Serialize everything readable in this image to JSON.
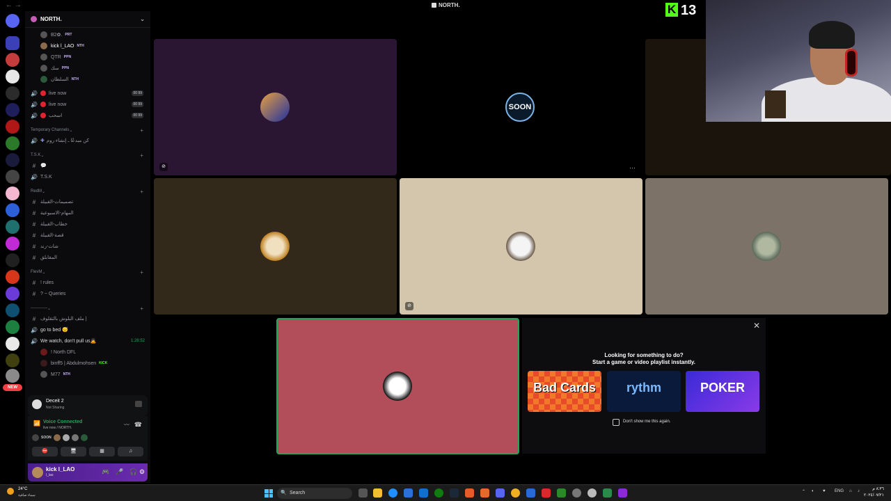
{
  "window": {
    "title": "NORTH."
  },
  "server": {
    "name": "NORTH."
  },
  "channels": {
    "users_top": [
      {
        "name": "B2✿.",
        "tag": "PRT"
      },
      {
        "name": "kick l_LAO",
        "tag": "NTH"
      },
      {
        "name": "QTR",
        "tag": "PPN"
      },
      {
        "name": "سك",
        "tag": "PPN"
      },
      {
        "name": "السلطان",
        "tag": "NTH"
      }
    ],
    "voice_live": [
      {
        "label": "live now",
        "limit": "00 99"
      },
      {
        "label": "live now",
        "limit": "00 99"
      },
      {
        "label": "اسحب",
        "limit": "00 99"
      }
    ],
    "temp_category": "Temporary Channels",
    "temp_create": "كن مبدعًا ـ إنشاء روم",
    "tsk_category": "T.S.K",
    "tsk_channels": [
      "T.S.K"
    ],
    "redm_category": "RedM",
    "redm_channels": [
      "تصميمات-القبيلة",
      "المهام-الاسبوعية",
      "خطاب-القبيلة",
      "قصة-القبيلة",
      "شات-رند",
      "المقابلق"
    ],
    "flevm_category": "FlevM",
    "flevm_channels": [
      "! rules",
      "? ~ Queries"
    ],
    "misc_category": "------------",
    "misc_text": "ملف البلوش بالتقلوف |",
    "bed_voice": "go to bed 😴",
    "watch_voice": "We watch, don't pull us🙇",
    "watch_time": "1:28:52",
    "watch_users": [
      {
        "name": "! North DFL",
        "tag": ""
      },
      {
        "name": "binff5 | Abdulmohsen",
        "tag": "KICK"
      },
      {
        "name": "M77",
        "tag": "NTH"
      }
    ]
  },
  "game_panel": {
    "name": "Deceit 2",
    "status": "Not Sharing"
  },
  "voice_panel": {
    "title": "Voice Connected",
    "channel": "live now / NORTH.",
    "soon_label": "SOON"
  },
  "user_panel": {
    "name": "kick l_LAO",
    "status": "l_lao"
  },
  "rail": {
    "new_label": "NEW"
  },
  "kick_overlay": {
    "count": "13"
  },
  "promo": {
    "title": "Looking for something to do?",
    "subtitle": "Start a game or video playlist instantly.",
    "dont_show": "Don't show me this again.",
    "cards": [
      "Bad Cards",
      "rythm",
      "POKER"
    ]
  },
  "tiles": {
    "soon_label": "SOON"
  },
  "taskbar": {
    "temp": "24°C",
    "condition": "سماء صافية",
    "search": "Search",
    "lang": "ENG",
    "time": "٨:٣٦ م",
    "date": "٢٠٢٤/٠٧/٢١"
  },
  "colors": {
    "accent": "#5865f2",
    "voice_green": "#23a55a",
    "live_red": "#e0232e",
    "kick_green": "#53fc18"
  }
}
